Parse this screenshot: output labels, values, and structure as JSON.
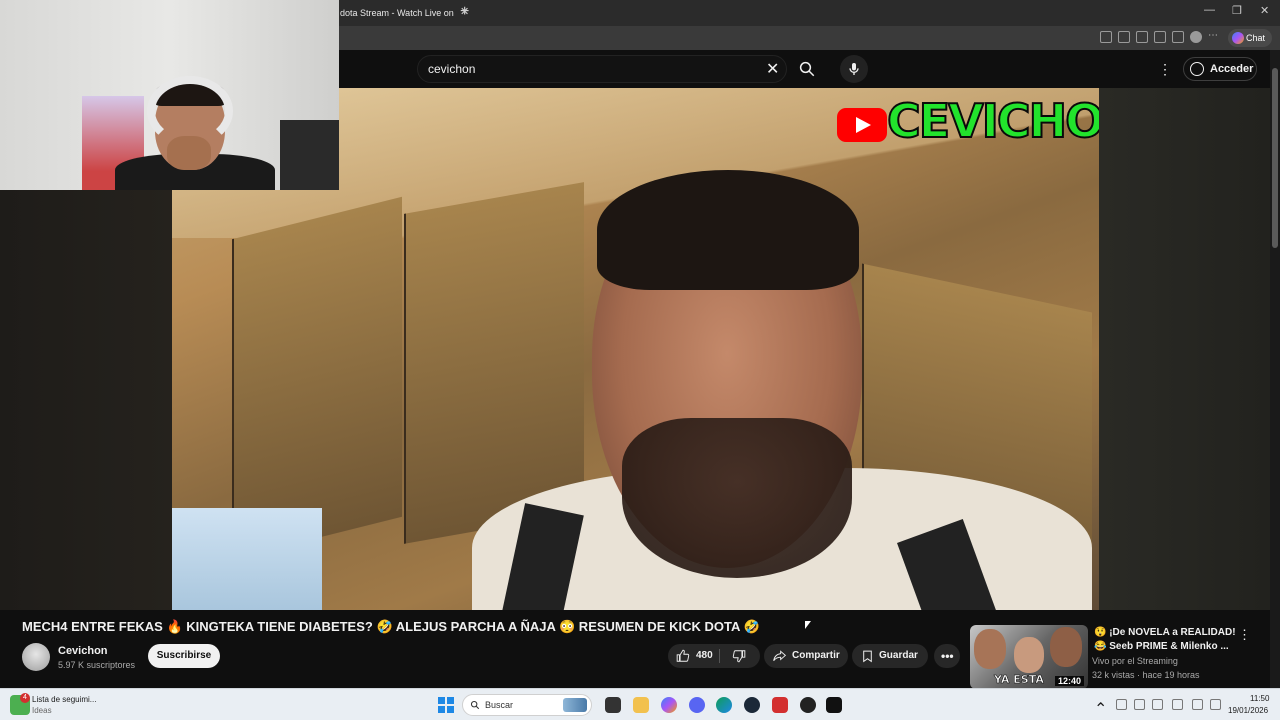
{
  "browser": {
    "tab_title": "dota Stream - Watch Live on K",
    "chat_label": "Chat"
  },
  "youtube": {
    "search_value": "cevichon",
    "signin_label": "Acceder",
    "overlay_logo_text": "CEVICHON"
  },
  "video": {
    "title": "MECH4 ENTRE FEKAS 🔥 KINGTEKA TIENE DIABETES? 🤣 ALEJUS PARCHA A ÑAJA 😳 RESUMEN DE KICK DOTA 🤣",
    "channel_name": "Cevichon",
    "subscribers": "5.97 K suscriptores",
    "subscribe_label": "Suscribirse",
    "like_count": "480",
    "share_label": "Compartir",
    "save_label": "Guardar",
    "more_label": "•••"
  },
  "recommendation": {
    "title_line1": "😲 ¡De NOVELA a REALIDAD!",
    "title_line2": "😂 Seeb PRIME & Milenko ...",
    "channel": "Vivo por el Streaming",
    "meta": "32 k vistas · hace 19 horas",
    "duration": "12:40",
    "thumb_text": "YA ESTA"
  },
  "taskbar": {
    "widget_line1": "Lista de seguimi...",
    "widget_line2": "Ideas",
    "widget_badge": "4",
    "search_label": "Buscar",
    "time": "11:50",
    "date": "19/01/2026"
  },
  "colors": {
    "accent_green": "#22e32c",
    "youtube_red": "#ff0000",
    "background": "#0f0f0f"
  }
}
